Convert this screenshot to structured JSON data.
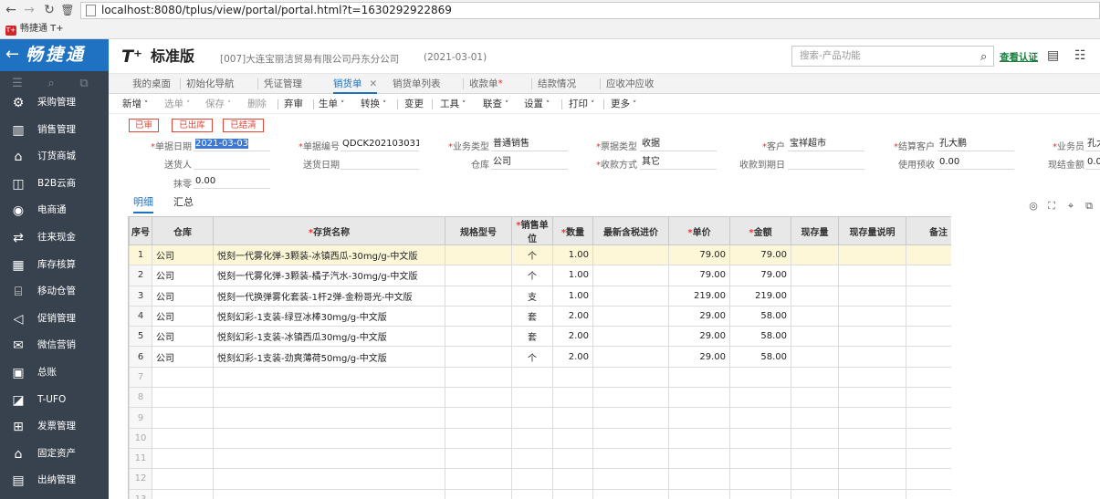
{
  "browser": {
    "url": "localhost:8080/tplus/view/portal/portal.html?t=1630292922869",
    "bookmark": "畅捷通 T+",
    "bookmark_logo": "T+"
  },
  "sidebar": {
    "brand": "畅捷通",
    "back_icon": "←",
    "items": [
      {
        "label": "采购管理",
        "icon": "cart-icon"
      },
      {
        "label": "销售管理",
        "icon": "chart-icon"
      },
      {
        "label": "订货商城",
        "icon": "store-icon"
      },
      {
        "label": "B2B云商",
        "icon": "bag-icon"
      },
      {
        "label": "电商通",
        "icon": "coin-icon"
      },
      {
        "label": "往来现金",
        "icon": "exchange-icon"
      },
      {
        "label": "库存核算",
        "icon": "warehouse-icon"
      },
      {
        "label": "移动仓管",
        "icon": "mobile-warehouse-icon"
      },
      {
        "label": "促销管理",
        "icon": "megaphone-icon"
      },
      {
        "label": "微信营销",
        "icon": "wechat-icon"
      },
      {
        "label": "总账",
        "icon": "ledger-icon"
      },
      {
        "label": "T-UFO",
        "icon": "ufo-icon"
      },
      {
        "label": "发票管理",
        "icon": "invoice-icon"
      },
      {
        "label": "固定资产",
        "icon": "bank-icon"
      },
      {
        "label": "出纳管理",
        "icon": "cashier-icon"
      }
    ]
  },
  "header": {
    "logo": "T⁺",
    "edition": "标准版",
    "company": "[007]大连宝丽洁贸易有限公司丹东分公司",
    "date": "(2021-03-01)",
    "search_placeholder": "搜索-产品功能",
    "verify_link": "查看认证"
  },
  "tabs": [
    {
      "label": "我的桌面"
    },
    {
      "label": "初始化导航"
    },
    {
      "label": "凭证管理"
    },
    {
      "label": "销货单",
      "active": true,
      "closable": true
    },
    {
      "label": "销货单列表"
    },
    {
      "label": "收款单",
      "required": true
    },
    {
      "label": "结款情况"
    },
    {
      "label": "应收冲应收"
    }
  ],
  "toolbar": [
    "新增",
    "选单",
    "保存",
    "删除",
    "弃审",
    "生单",
    "转换",
    "变更",
    "工具",
    "联查",
    "设置",
    "打印",
    "更多"
  ],
  "stamps": [
    "已审",
    "已出库",
    "已结清"
  ],
  "form": {
    "doc_date_label": "单据日期",
    "doc_date": "2021-03-03",
    "doc_no_label": "单据编号",
    "doc_no": "QDCK202103031...",
    "biz_type_label": "业务类型",
    "biz_type": "普通销售",
    "invoice_type_label": "票据类型",
    "invoice_type": "收据",
    "customer_label": "客户",
    "customer": "宝祥超市",
    "settle_customer_label": "结算客户",
    "settle_customer": "孔大鹏",
    "salesman_label": "业务员",
    "salesman": "孔大",
    "shipper_label": "送货人",
    "ship_date_label": "送货日期",
    "warehouse_label": "仓库",
    "warehouse": "公司",
    "pay_method_label": "收款方式",
    "pay_method": "其它",
    "due_date_label": "收款到期日",
    "prepay_label": "使用预收",
    "prepay": "0.00",
    "cash_settle_label": "现结金额",
    "cash_settle": "0.0",
    "rounding_label": "抹零",
    "rounding": "0.00"
  },
  "subtabs": [
    "明细",
    "汇总"
  ],
  "grid": {
    "columns": [
      "序号",
      "仓库",
      "存货名称",
      "规格型号",
      "销售单位",
      "数量",
      "最新含税进价",
      "单价",
      "金额",
      "现存量",
      "现存量说明",
      "备注"
    ],
    "required_columns": [
      "存货名称",
      "销售单位",
      "数量",
      "单价",
      "金额"
    ],
    "rows": [
      {
        "no": "1",
        "warehouse": "公司",
        "name": "悦刻一代雾化弹-3颗装-冰镇西瓜-30mg/g-中文版",
        "spec": "",
        "unit": "个",
        "qty": "1.00",
        "cost": "",
        "price": "79.00",
        "amount": "79.00"
      },
      {
        "no": "2",
        "warehouse": "公司",
        "name": "悦刻一代雾化弹-3颗装-橘子汽水-30mg/g-中文版",
        "spec": "",
        "unit": "个",
        "qty": "1.00",
        "cost": "",
        "price": "79.00",
        "amount": "79.00"
      },
      {
        "no": "3",
        "warehouse": "公司",
        "name": "悦刻一代换弹雾化套装-1杆2弹-金粉哥光-中文版",
        "spec": "",
        "unit": "支",
        "qty": "1.00",
        "cost": "",
        "price": "219.00",
        "amount": "219.00"
      },
      {
        "no": "4",
        "warehouse": "公司",
        "name": "悦刻幻彩-1支装-绿豆冰棒30mg/g-中文版",
        "spec": "",
        "unit": "套",
        "qty": "2.00",
        "cost": "",
        "price": "29.00",
        "amount": "58.00"
      },
      {
        "no": "5",
        "warehouse": "公司",
        "name": "悦刻幻彩-1支装-冰镇西瓜30mg/g-中文版",
        "spec": "",
        "unit": "套",
        "qty": "2.00",
        "cost": "",
        "price": "29.00",
        "amount": "58.00"
      },
      {
        "no": "6",
        "warehouse": "公司",
        "name": "悦刻幻彩-1支装-劲爽薄荷50mg/g-中文版",
        "spec": "",
        "unit": "个",
        "qty": "2.00",
        "cost": "",
        "price": "29.00",
        "amount": "58.00"
      }
    ],
    "empty_rows": [
      "7",
      "8",
      "9",
      "10",
      "11",
      "12",
      "13"
    ]
  }
}
